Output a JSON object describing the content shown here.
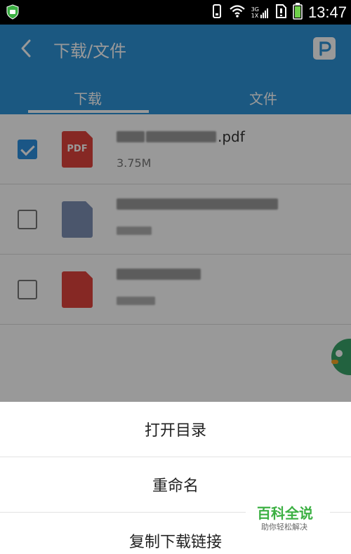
{
  "status_bar": {
    "time": "13:47",
    "network_top": "3G",
    "network_bottom": "1X"
  },
  "app_bar": {
    "title": "下载/文件",
    "back_icon": "back-arrow-icon",
    "action_icon": "p-badge-icon",
    "accent_color": "#2e93d8"
  },
  "tabs": [
    {
      "label": "下载",
      "selected": true
    },
    {
      "label": "文件",
      "selected": false
    }
  ],
  "files": [
    {
      "checked": true,
      "type_label": "PDF",
      "name_suffix": ".pdf",
      "size": "3.75M"
    },
    {
      "checked": false,
      "type_label": "",
      "name_suffix": "",
      "size": ""
    },
    {
      "checked": false,
      "type_label": "",
      "name_suffix": "",
      "size": ""
    }
  ],
  "sheet": {
    "items": [
      "打开目录",
      "重命名",
      "复制下载链接"
    ]
  },
  "watermark": {
    "title": "百科全说",
    "subtitle": "助你轻松解决"
  }
}
